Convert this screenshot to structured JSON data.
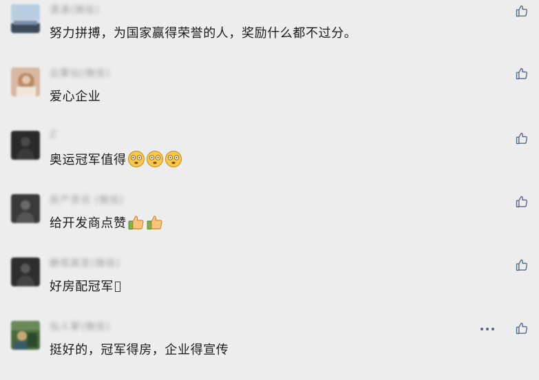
{
  "comments": [
    {
      "nickname": "潇潇(微信)",
      "text": "努力拼搏，为国家赢得荣誉的人，奖励什么都不过分。"
    },
    {
      "nickname": "云雾仙(微信)",
      "text": "爱心企业"
    },
    {
      "nickname": "Z",
      "text": "奥运冠军值得"
    },
    {
      "nickname": "房产资讯 (微信)",
      "text": "给开发商点赞"
    },
    {
      "nickname": "静观其变(微信)",
      "text": "好房配冠军"
    },
    {
      "nickname": "仙人掌(微信)",
      "text": "挺好的，冠军得房，企业得宣传"
    }
  ],
  "colors": {
    "background": "#ededed",
    "text": "#1a1a1a",
    "icon": "#5a6a8a"
  }
}
